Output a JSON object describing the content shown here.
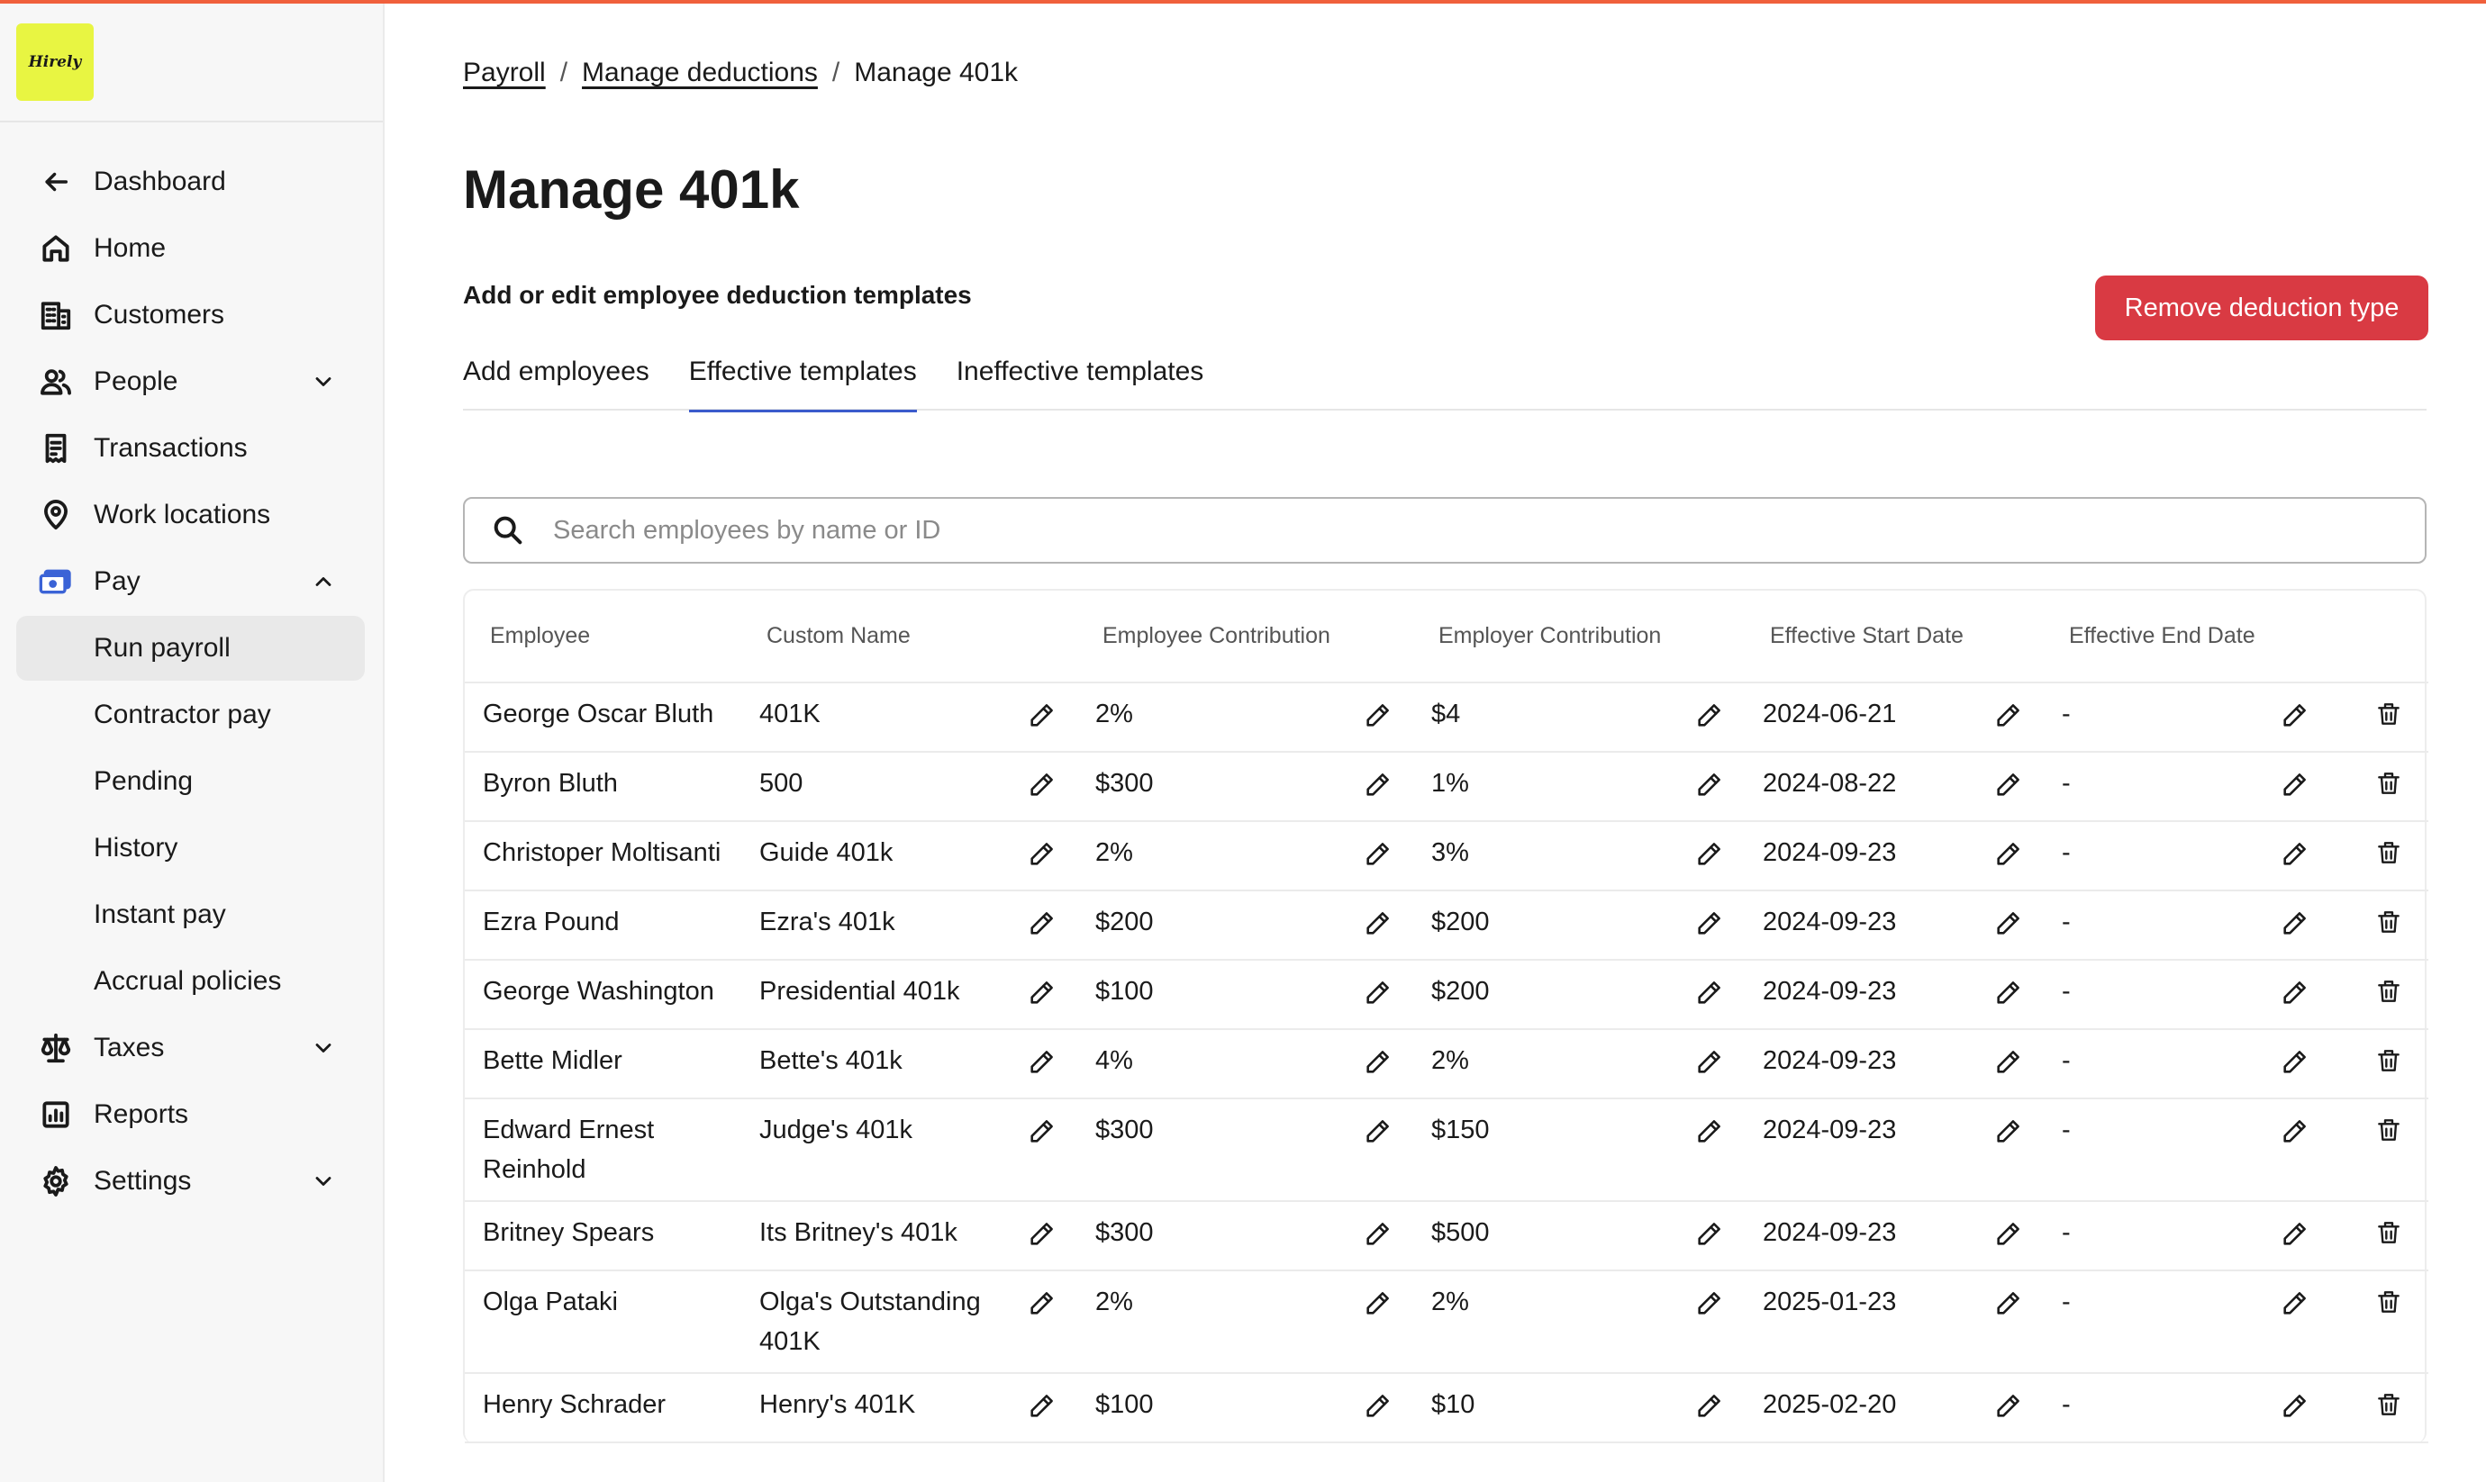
{
  "app": {
    "logo_text": "Hirely"
  },
  "sidebar": {
    "back": {
      "label": "Dashboard",
      "icon": "arrow-left-icon"
    },
    "items": [
      {
        "label": "Home",
        "icon": "home-icon"
      },
      {
        "label": "Customers",
        "icon": "building-icon"
      },
      {
        "label": "People",
        "icon": "people-icon",
        "expandable": true
      },
      {
        "label": "Transactions",
        "icon": "receipt-icon"
      },
      {
        "label": "Work locations",
        "icon": "map-pin-icon"
      },
      {
        "label": "Pay",
        "icon": "money-icon",
        "expanded": true
      }
    ],
    "pay_sub": [
      "Run payroll",
      "Contractor pay",
      "Pending",
      "History",
      "Instant pay",
      "Accrual policies"
    ],
    "active_sub": "Run payroll",
    "bottom_items": [
      {
        "label": "Taxes",
        "icon": "scale-icon"
      },
      {
        "label": "Reports",
        "icon": "chart-icon"
      },
      {
        "label": "Settings",
        "icon": "gear-icon"
      }
    ]
  },
  "breadcrumb": [
    "Payroll",
    "Manage deductions",
    "Manage 401k"
  ],
  "page": {
    "title": "Manage 401k",
    "subtitle": "Add or edit employee deduction templates",
    "remove_button": "Remove deduction type"
  },
  "tabs": [
    "Add employees",
    "Effective templates",
    "Ineffective templates"
  ],
  "active_tab": "Effective templates",
  "search": {
    "placeholder": "Search employees by name or ID",
    "value": ""
  },
  "table": {
    "headers": [
      "Employee",
      "Custom Name",
      "Employee Contribution",
      "Employer Contribution",
      "Effective Start Date",
      "Effective End Date"
    ],
    "rows": [
      [
        "George Oscar Bluth",
        "401K",
        "2%",
        "$4",
        "2024-06-21",
        "-"
      ],
      [
        "Byron Bluth",
        "500",
        "$300",
        "1%",
        "2024-08-22",
        "-"
      ],
      [
        "Christoper Moltisanti",
        "Guide 401k",
        "2%",
        "3%",
        "2024-09-23",
        "-"
      ],
      [
        "Ezra Pound",
        "Ezra's 401k",
        "$200",
        "$200",
        "2024-09-23",
        "-"
      ],
      [
        "George Washington",
        "Presidential 401k",
        "$100",
        "$200",
        "2024-09-23",
        "-"
      ],
      [
        "Bette Midler",
        "Bette's 401k",
        "4%",
        "2%",
        "2024-09-23",
        "-"
      ],
      [
        "Edward Ernest Reinhold",
        "Judge's 401k",
        "$300",
        "$150",
        "2024-09-23",
        "-"
      ],
      [
        "Britney Spears",
        "Its Britney's 401k",
        "$300",
        "$500",
        "2024-09-23",
        "-"
      ],
      [
        "Olga Pataki",
        "Olga's Outstanding 401K",
        "2%",
        "2%",
        "2025-01-23",
        "-"
      ],
      [
        "Henry Schrader",
        "Henry's 401K",
        "$100",
        "$10",
        "2025-02-20",
        "-"
      ]
    ]
  },
  "colors": {
    "accent_bar": "#f0603c",
    "danger": "#d93a43",
    "tab_underline": "#3b5bcc",
    "logo_bg": "#e8f542"
  }
}
